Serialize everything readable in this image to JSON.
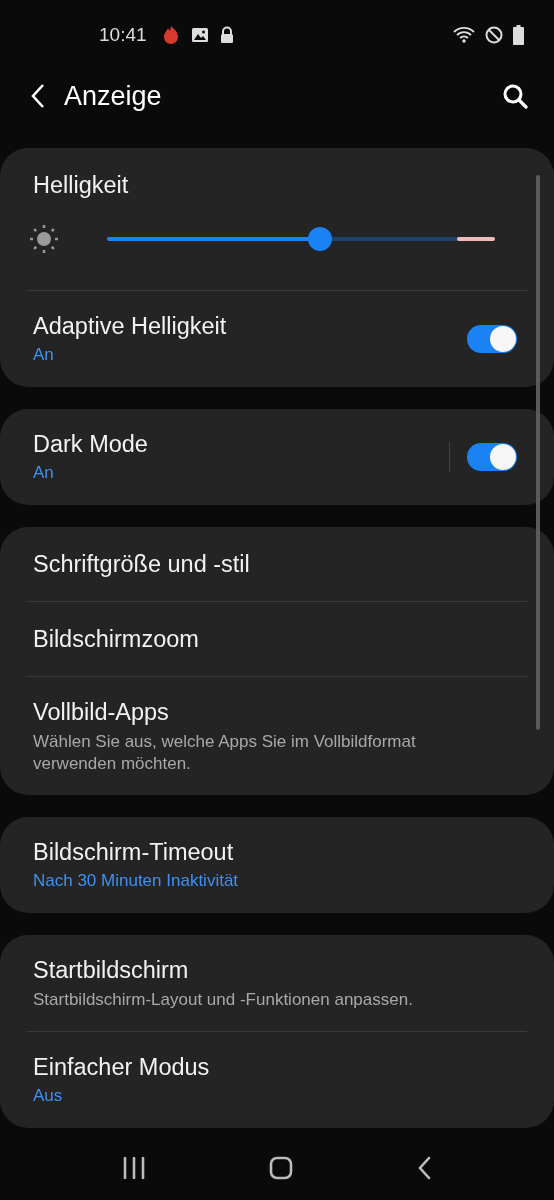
{
  "status_bar": {
    "time": "10:41"
  },
  "header": {
    "title": "Anzeige"
  },
  "cards": [
    {
      "items": [
        {
          "kind": "slider",
          "title": "Helligkeit",
          "level": 0.55
        },
        {
          "kind": "switch",
          "title": "Adaptive Helligkeit",
          "summary": "An",
          "on": true,
          "split": false
        }
      ]
    },
    {
      "items": [
        {
          "kind": "switch",
          "title": "Dark Mode",
          "summary": "An",
          "on": true,
          "split": true
        }
      ]
    },
    {
      "items": [
        {
          "kind": "link",
          "title": "Schriftgröße und -stil"
        },
        {
          "kind": "link",
          "title": "Bildschirmzoom"
        },
        {
          "kind": "link",
          "title": "Vollbild-Apps",
          "description": "Wählen Sie aus, welche Apps Sie im Vollbildformat verwenden möchten."
        }
      ]
    },
    {
      "items": [
        {
          "kind": "link",
          "title": "Bildschirm-Timeout",
          "summary": "Nach 30 Minuten Inaktivität"
        }
      ]
    },
    {
      "items": [
        {
          "kind": "link",
          "title": "Startbildschirm",
          "description": "Startbildschirm-Layout und -Funktionen anpassen."
        },
        {
          "kind": "link",
          "title": "Einfacher Modus",
          "summary": "Aus"
        }
      ]
    }
  ]
}
